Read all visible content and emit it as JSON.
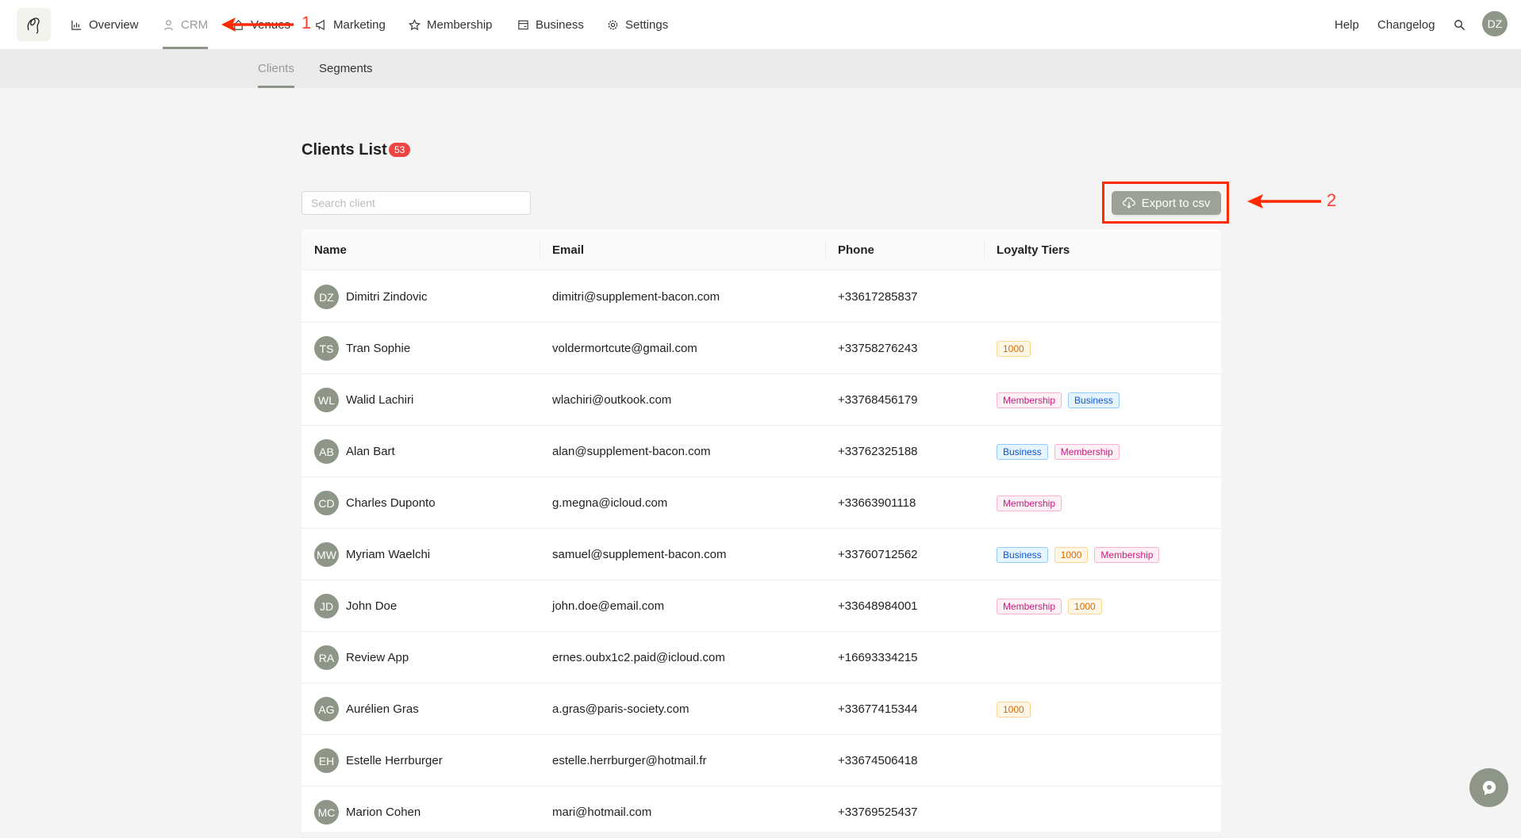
{
  "nav": {
    "items": [
      {
        "label": "Overview",
        "icon": "chart-icon"
      },
      {
        "label": "CRM",
        "icon": "user-icon",
        "active": true
      },
      {
        "label": "Venues",
        "icon": "venue-icon"
      },
      {
        "label": "Marketing",
        "icon": "megaphone-icon"
      },
      {
        "label": "Membership",
        "icon": "star-icon"
      },
      {
        "label": "Business",
        "icon": "card-icon"
      },
      {
        "label": "Settings",
        "icon": "gear-icon"
      }
    ],
    "help": "Help",
    "changelog": "Changelog",
    "user_initials": "DZ"
  },
  "subnav": {
    "clients": "Clients",
    "segments": "Segments"
  },
  "page": {
    "title": "Clients List",
    "count": "53",
    "search_placeholder": "Search client",
    "export_label": "Export to csv"
  },
  "annotations": {
    "one": "1",
    "two": "2"
  },
  "table": {
    "headers": {
      "name": "Name",
      "email": "Email",
      "phone": "Phone",
      "loyalty": "Loyalty Tiers"
    },
    "rows": [
      {
        "initials": "DZ",
        "name": "Dimitri Zindovic",
        "email": "dimitri@supplement-bacon.com",
        "phone": "+33617285837",
        "tiers": []
      },
      {
        "initials": "TS",
        "name": "Tran Sophie",
        "email": "voldermortcute@gmail.com",
        "phone": "+33758276243",
        "tiers": [
          "1000"
        ]
      },
      {
        "initials": "WL",
        "name": "Walid Lachiri",
        "email": "wlachiri@outkook.com",
        "phone": "+33768456179",
        "tiers": [
          "Membership",
          "Business"
        ]
      },
      {
        "initials": "AB",
        "name": "Alan Bart",
        "email": "alan@supplement-bacon.com",
        "phone": "+33762325188",
        "tiers": [
          "Business",
          "Membership"
        ]
      },
      {
        "initials": "CD",
        "name": "Charles Duponto",
        "email": "g.megna@icloud.com",
        "phone": "+33663901118",
        "tiers": [
          "Membership"
        ]
      },
      {
        "initials": "MW",
        "name": "Myriam Waelchi",
        "email": "samuel@supplement-bacon.com",
        "phone": "+33760712562",
        "tiers": [
          "Business",
          "1000",
          "Membership"
        ]
      },
      {
        "initials": "JD",
        "name": "John Doe",
        "email": "john.doe@email.com",
        "phone": "+33648984001",
        "tiers": [
          "Membership",
          "1000"
        ]
      },
      {
        "initials": "RA",
        "name": "Review App",
        "email": "ernes.oubx1c2.paid@icloud.com",
        "phone": "+16693334215",
        "tiers": []
      },
      {
        "initials": "AG",
        "name": "Aurélien Gras",
        "email": "a.gras@paris-society.com",
        "phone": "+33677415344",
        "tiers": [
          "1000"
        ]
      },
      {
        "initials": "EH",
        "name": "Estelle Herrburger",
        "email": "estelle.herrburger@hotmail.fr",
        "phone": "+33674506418",
        "tiers": []
      },
      {
        "initials": "MC",
        "name": "Marion Cohen",
        "email": "mari@hotmail.com",
        "phone": "+33769525437",
        "tiers": []
      }
    ]
  },
  "colors": {
    "accent": "#8e9787",
    "badge": "#ef4444",
    "annotation": "#ff2a00"
  }
}
